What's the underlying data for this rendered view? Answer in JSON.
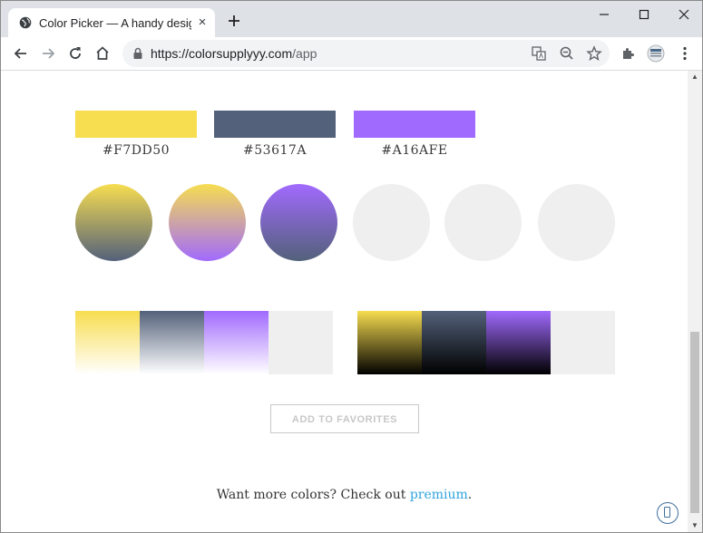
{
  "browser": {
    "tab_title": "Color Picker — A handy design tool",
    "tab_close": "×",
    "url_host": "https://colorsupplyyy.com",
    "url_path": "/app"
  },
  "colors": {
    "yellow": "#F7DD50",
    "slate": "#53617A",
    "purple": "#A16AFE",
    "empty": "#F0EFEF"
  },
  "swatches": [
    {
      "hex": "#F7DD50"
    },
    {
      "hex": "#53617A"
    },
    {
      "hex": "#A16AFE"
    }
  ],
  "actions": {
    "favorites_label": "ADD TO FAVORITES"
  },
  "footer": {
    "text": "Want more colors? Check out ",
    "link": "premium",
    "suffix": "."
  }
}
